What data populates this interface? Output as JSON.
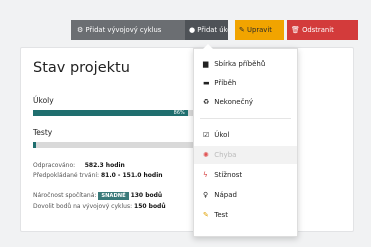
{
  "toolbar": {
    "cycle_label": "Přidat vývojový cyklus",
    "task_label": "Přidat úkol",
    "edit_label": "Upravit",
    "delete_label": "Odstranit"
  },
  "panel": {
    "title": "Stav projektu",
    "tasks_label": "Úkoly",
    "tasks_progress": "86%",
    "tasks_progress_value": 0.86,
    "tests_label": "Testy",
    "tests_progress_value": 0.0,
    "worked_label": "Odpracováno:",
    "worked_value": "582.3 hodin",
    "expected_label": "Předpokládané trvání:",
    "expected_value": "81.0 - 151.0 hodin",
    "difficulty_label": "Náročnost spočítaná:",
    "difficulty_badge": "SNADNÉ",
    "difficulty_points": "130 bodů",
    "remaining_label": "Dovolit bodů na vývojový cyklus:",
    "remaining_value": "150 bodů"
  },
  "dropdown": {
    "group1": [
      {
        "label": "Sbírka příběhů",
        "icon": "book-icon"
      },
      {
        "label": "Příběh",
        "icon": "card-icon"
      },
      {
        "label": "Nekonečný",
        "icon": "recycle-icon"
      }
    ],
    "group2": [
      {
        "label": "Úkol",
        "icon": "checkbox-icon",
        "disabled": false
      },
      {
        "label": "Chyba",
        "icon": "bug-icon",
        "disabled": true
      },
      {
        "label": "Stížnost",
        "icon": "lightning-icon",
        "disabled": false
      },
      {
        "label": "Nápad",
        "icon": "lightbulb-icon",
        "disabled": false
      },
      {
        "label": "Test",
        "icon": "pencil-icon",
        "disabled": false
      }
    ]
  },
  "colors": {
    "accent_teal": "#1f6e6e",
    "edit_orange": "#f1a400",
    "delete_red": "#d33b3b"
  }
}
